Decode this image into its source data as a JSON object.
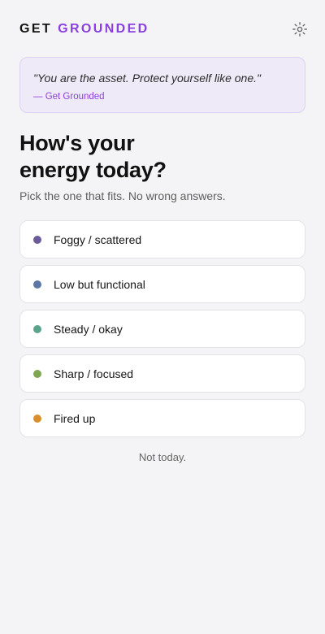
{
  "brand": {
    "word1": "GET",
    "word2": "GROUNDED",
    "accent": "#8b3fe0"
  },
  "header": {
    "settings_icon": "gear-icon"
  },
  "quote": {
    "text": "\"You are the asset. Protect yourself like one.\"",
    "attribution": "— Get Grounded"
  },
  "prompt": {
    "line1": "How's your",
    "line2": "energy today?",
    "subtitle": "Pick the one that fits. No wrong answers."
  },
  "options": [
    {
      "label": "Foggy / scattered",
      "color": "#6b5b9a"
    },
    {
      "label": "Low but functional",
      "color": "#5b77a3"
    },
    {
      "label": "Steady / okay",
      "color": "#5aa38c"
    },
    {
      "label": "Sharp / focused",
      "color": "#7fa650"
    },
    {
      "label": "Fired up",
      "color": "#d98f2b"
    }
  ],
  "skip_label": "Not today."
}
